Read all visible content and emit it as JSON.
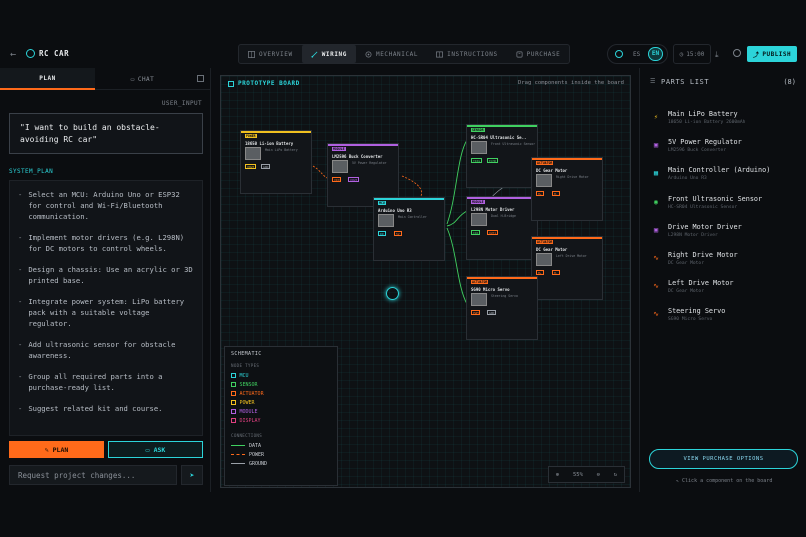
{
  "header": {
    "back_icon": "arrow-left-icon",
    "project_title": "RC CAR",
    "tabs": [
      {
        "label": "OVERVIEW",
        "icon": "grid-icon"
      },
      {
        "label": "WIRING",
        "icon": "wire-icon",
        "active": true
      },
      {
        "label": "MECHANICAL",
        "icon": "gear-icon"
      },
      {
        "label": "INSTRUCTIONS",
        "icon": "book-icon"
      },
      {
        "label": "PURCHASE",
        "icon": "cart-icon"
      }
    ],
    "lang_es": "ES",
    "lang_en": "EN",
    "time": "15:00",
    "publish_label": "PUBLISH"
  },
  "left_panel": {
    "tab_plan": "PLAN",
    "tab_chat": "CHAT",
    "user_input_label": "USER_INPUT",
    "user_prompt": "\"I want to build an obstacle-avoiding RC car\"",
    "system_plan_label": "SYSTEM_PLAN",
    "plan_items": [
      "Select an MCU: Arduino Uno or ESP32 for control and Wi-Fi/Bluetooth communication.",
      "Implement motor drivers (e.g. L298N) for DC motors to control wheels.",
      "Design a chassis: Use an acrylic or 3D printed base.",
      "Integrate power system: LiPo battery pack with a suitable voltage regulator.",
      "Add ultrasonic sensor for obstacle awareness.",
      "Group all required parts into a purchase-ready list.",
      "Suggest related kit and course."
    ],
    "plan_button": "PLAN",
    "ask_button": "ASK",
    "request_placeholder": "Request project changes..."
  },
  "board": {
    "title": "PROTOTYPE BOARD",
    "hint": "Drag components inside the board",
    "nodes": [
      {
        "id": "battery",
        "tag": "POWER",
        "name": "18650 Li-ion Battery",
        "sub": "Main LiPo Battery",
        "color": "#f0c020",
        "p1": "VOUT",
        "p2": "GND"
      },
      {
        "id": "buck",
        "tag": "MODULE",
        "name": "LM2596 Buck Converter",
        "sub": "5V Power Regulator",
        "color": "#b060e0",
        "p1": "VIN",
        "p2": "VOUT"
      },
      {
        "id": "arduino",
        "tag": "MCU",
        "name": "Arduino Uno R3",
        "sub": "Main Controller",
        "color": "#2cd4d9",
        "p1": "D9",
        "p2": "5V"
      },
      {
        "id": "ultra",
        "tag": "SENSOR",
        "name": "HC-SR04 Ultrasonic Se..",
        "sub": "Front Ultrasonic Sensor",
        "color": "#40d060",
        "p1": "TRIG",
        "p2": "ECHO"
      },
      {
        "id": "l298n",
        "tag": "MODULE",
        "name": "L298N Motor Driver",
        "sub": "Dual H-Bridge",
        "color": "#b060e0",
        "p1": "IN1",
        "p2": "OUT1"
      },
      {
        "id": "rmotor",
        "tag": "ACTUATOR",
        "name": "DC Gear Motor",
        "sub": "Right Drive Motor",
        "color": "#ff6a1a",
        "p1": "M+",
        "p2": "M-"
      },
      {
        "id": "lmotor",
        "tag": "ACTUATOR",
        "name": "DC Gear Motor",
        "sub": "Left Drive Motor",
        "color": "#ff6a1a",
        "p1": "M+",
        "p2": "M-"
      },
      {
        "id": "servo",
        "tag": "ACTUATOR",
        "name": "SG90 Micro Servo",
        "sub": "Steering Servo",
        "color": "#ff6a1a",
        "p1": "PWM",
        "p2": "GND"
      }
    ],
    "schematic": {
      "title": "SCHEMATIC",
      "node_types_label": "NODE TYPES",
      "node_types": [
        {
          "label": "MCU",
          "color": "#2cd4d9"
        },
        {
          "label": "SENSOR",
          "color": "#40d060"
        },
        {
          "label": "ACTUATOR",
          "color": "#ff6a1a"
        },
        {
          "label": "POWER",
          "color": "#f0c020"
        },
        {
          "label": "MODULE",
          "color": "#b060e0"
        },
        {
          "label": "DISPLAY",
          "color": "#e04080"
        }
      ],
      "connections_label": "CONNECTIONS",
      "connections": [
        {
          "label": "DATA",
          "color": "#40d060"
        },
        {
          "label": "POWER",
          "color": "#ff6a1a"
        },
        {
          "label": "GROUND",
          "color": "#9aa0a8"
        }
      ]
    },
    "zoom": "55%"
  },
  "parts": {
    "title": "PARTS LIST",
    "count": "(8)",
    "items": [
      {
        "name": "Main LiPo Battery",
        "sub": "18650 Li-ion Battery 2600mAh",
        "icon": "bolt-icon",
        "color": "#f0c020",
        "glyph": "⚡"
      },
      {
        "name": "5V Power Regulator",
        "sub": "LM2596 Buck Converter",
        "icon": "module-icon",
        "color": "#b060e0",
        "glyph": "▣"
      },
      {
        "name": "Main Controller (Arduino)",
        "sub": "Arduino Uno R3",
        "icon": "chip-icon",
        "color": "#2cd4d9",
        "glyph": "▦"
      },
      {
        "name": "Front Ultrasonic Sensor",
        "sub": "HC-SR04 Ultrasonic Sensor",
        "icon": "signal-icon",
        "color": "#40d060",
        "glyph": "◉"
      },
      {
        "name": "Drive Motor Driver",
        "sub": "L298N Motor Driver",
        "icon": "module-icon",
        "color": "#b060e0",
        "glyph": "▣"
      },
      {
        "name": "Right Drive Motor",
        "sub": "DC Gear Motor",
        "icon": "pulse-icon",
        "color": "#ff6a1a",
        "glyph": "∿"
      },
      {
        "name": "Left Drive Motor",
        "sub": "DC Gear Motor",
        "icon": "pulse-icon",
        "color": "#ff6a1a",
        "glyph": "∿"
      },
      {
        "name": "Steering Servo",
        "sub": "SG90 Micro Servo",
        "icon": "pulse-icon",
        "color": "#ff6a1a",
        "glyph": "∿"
      }
    ],
    "view_button": "VIEW PURCHASE OPTIONS",
    "click_hint": "Click a component on the board"
  }
}
